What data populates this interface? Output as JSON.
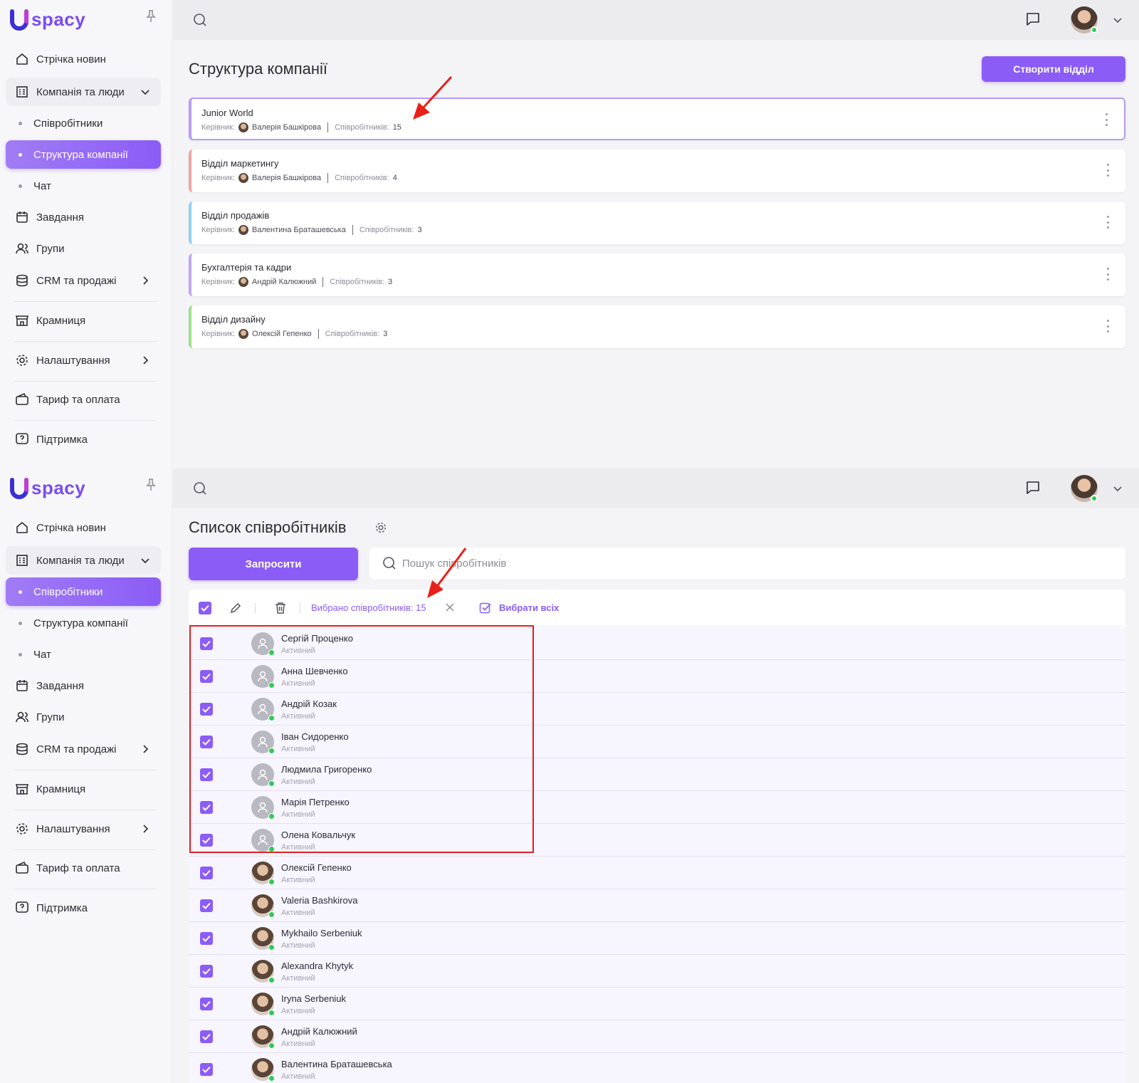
{
  "app": {
    "logo_text": "spacy"
  },
  "top": {
    "sidebar": {
      "items": [
        {
          "label": "Стрічка новин",
          "icon": "home-icon"
        },
        {
          "label": "Компанія та люди",
          "icon": "building-icon"
        },
        {
          "label": "Співробітники"
        },
        {
          "label": "Структура компанії"
        },
        {
          "label": "Чат"
        },
        {
          "label": "Завдання",
          "icon": "calendar-icon"
        },
        {
          "label": "Групи",
          "icon": "users-icon"
        },
        {
          "label": "CRM та продажі",
          "icon": "database-icon"
        },
        {
          "label": "Крамниця",
          "icon": "store-icon"
        },
        {
          "label": "Налаштування",
          "icon": "gear-icon"
        },
        {
          "label": "Тариф та оплата",
          "icon": "wallet-icon"
        },
        {
          "label": "Підтримка",
          "icon": "help-icon"
        }
      ],
      "active": "Структура компанії"
    },
    "title": "Структура компанії",
    "create_button": "Створити відділ",
    "manager_label": "Керівник:",
    "count_label": "Співробітників:",
    "departments": [
      {
        "name": "Junior World",
        "manager": "Валерія Башкірова",
        "count": "15",
        "color": "#b79bf6"
      },
      {
        "name": "Відділ маркетингу",
        "manager": "Валерія Башкірова",
        "count": "4",
        "color": "#f4a3a3"
      },
      {
        "name": "Відділ продажів",
        "manager": "Валентина Браташевська",
        "count": "3",
        "color": "#8fd0f2"
      },
      {
        "name": "Бухгалтерія та кадри",
        "manager": "Андрій Калюжний",
        "count": "3",
        "color": "#c2a6f2"
      },
      {
        "name": "Відділ дизайну",
        "manager": "Олексій Гепенко",
        "count": "3",
        "color": "#9ee08e"
      }
    ]
  },
  "bottom": {
    "sidebar": {
      "active": "Співробітники"
    },
    "title": "Список співробітників",
    "invite_button": "Запросити",
    "search_placeholder": "Пошук співробітників",
    "selected_text": "Вибрано співробітників: 15",
    "select_all": "Вибрати всіх",
    "employees": [
      {
        "name": "Сергій Проценко",
        "status": "Активний",
        "photo": false
      },
      {
        "name": "Анна Шевченко",
        "status": "Активний",
        "photo": false
      },
      {
        "name": "Андрій Козак",
        "status": "Активний",
        "photo": false
      },
      {
        "name": "Іван Сидоренко",
        "status": "Активний",
        "photo": false
      },
      {
        "name": "Людмила Григоренко",
        "status": "Активний",
        "photo": false
      },
      {
        "name": "Марія Петренко",
        "status": "Активний",
        "photo": false
      },
      {
        "name": "Олена Ковальчук",
        "status": "Активний",
        "photo": false
      },
      {
        "name": "Олексій Гепенко",
        "status": "Активний",
        "photo": true
      },
      {
        "name": "Valeria Bashkirova",
        "status": "Активний",
        "photo": true
      },
      {
        "name": "Mykhailo Serbeniuk",
        "status": "Активний",
        "photo": true
      },
      {
        "name": "Alexandra Khytyk",
        "status": "Активний",
        "photo": true
      },
      {
        "name": "Iryna Serbeniuk",
        "status": "Активний",
        "photo": true
      },
      {
        "name": "Андрій Калюжний",
        "status": "Активний",
        "photo": true
      },
      {
        "name": "Валентина Браташевська",
        "status": "Активний",
        "photo": true
      }
    ]
  },
  "colors": {
    "accent": "#8b5cf6",
    "highlight_box": "#e02020",
    "online": "#2ecc52"
  }
}
